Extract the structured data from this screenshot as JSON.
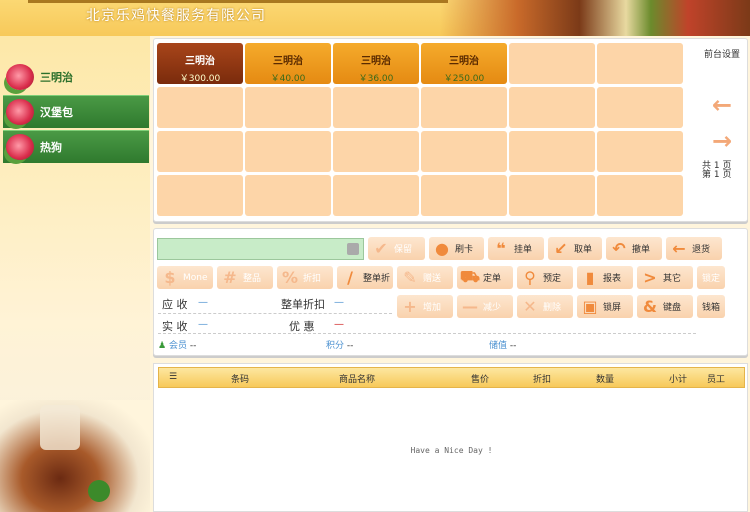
{
  "header": {
    "title": "北京乐鸡快餐服务有限公司"
  },
  "categories": [
    {
      "label": "三明治"
    },
    {
      "label": "汉堡包"
    },
    {
      "label": "热狗"
    }
  ],
  "products": [
    {
      "name": "三明治",
      "price": "￥300.00"
    },
    {
      "name": "三明治",
      "price": "￥40.00"
    },
    {
      "name": "三明治",
      "price": "￥36.00"
    },
    {
      "name": "三明治",
      "price": "￥250.00"
    }
  ],
  "side": {
    "settings": "前台设置",
    "total_pages": "共 1 页",
    "current_page": "第 1 页"
  },
  "toolbar": {
    "row1": [
      "保留",
      "刷卡",
      "挂单",
      "取单",
      "撤单",
      "退货"
    ],
    "row2": [
      "Mone",
      "整品",
      "折扣",
      "整单折",
      "赠送",
      "定单",
      "预定",
      "报表",
      "其它",
      "锁定"
    ],
    "row3": [
      "增加",
      "减少",
      "删除",
      "锁屏",
      "键盘",
      "钱箱"
    ]
  },
  "totals": {
    "receivable_label": "应 收",
    "receivable_value": "—",
    "discount_label": "整单折扣",
    "discount_value": "—",
    "paid_label": "实 收",
    "paid_value": "—",
    "promo_label": "优 惠",
    "promo_value": "—"
  },
  "member": {
    "member_label": "会员",
    "member_value": "--",
    "points_label": "积分",
    "points_value": "--",
    "balance_label": "储值",
    "balance_value": "--"
  },
  "table": {
    "columns": [
      "条码",
      "商品名称",
      "售价",
      "折扣",
      "数量",
      "小计",
      "员工"
    ],
    "empty_text": "Have a Nice Day !"
  }
}
